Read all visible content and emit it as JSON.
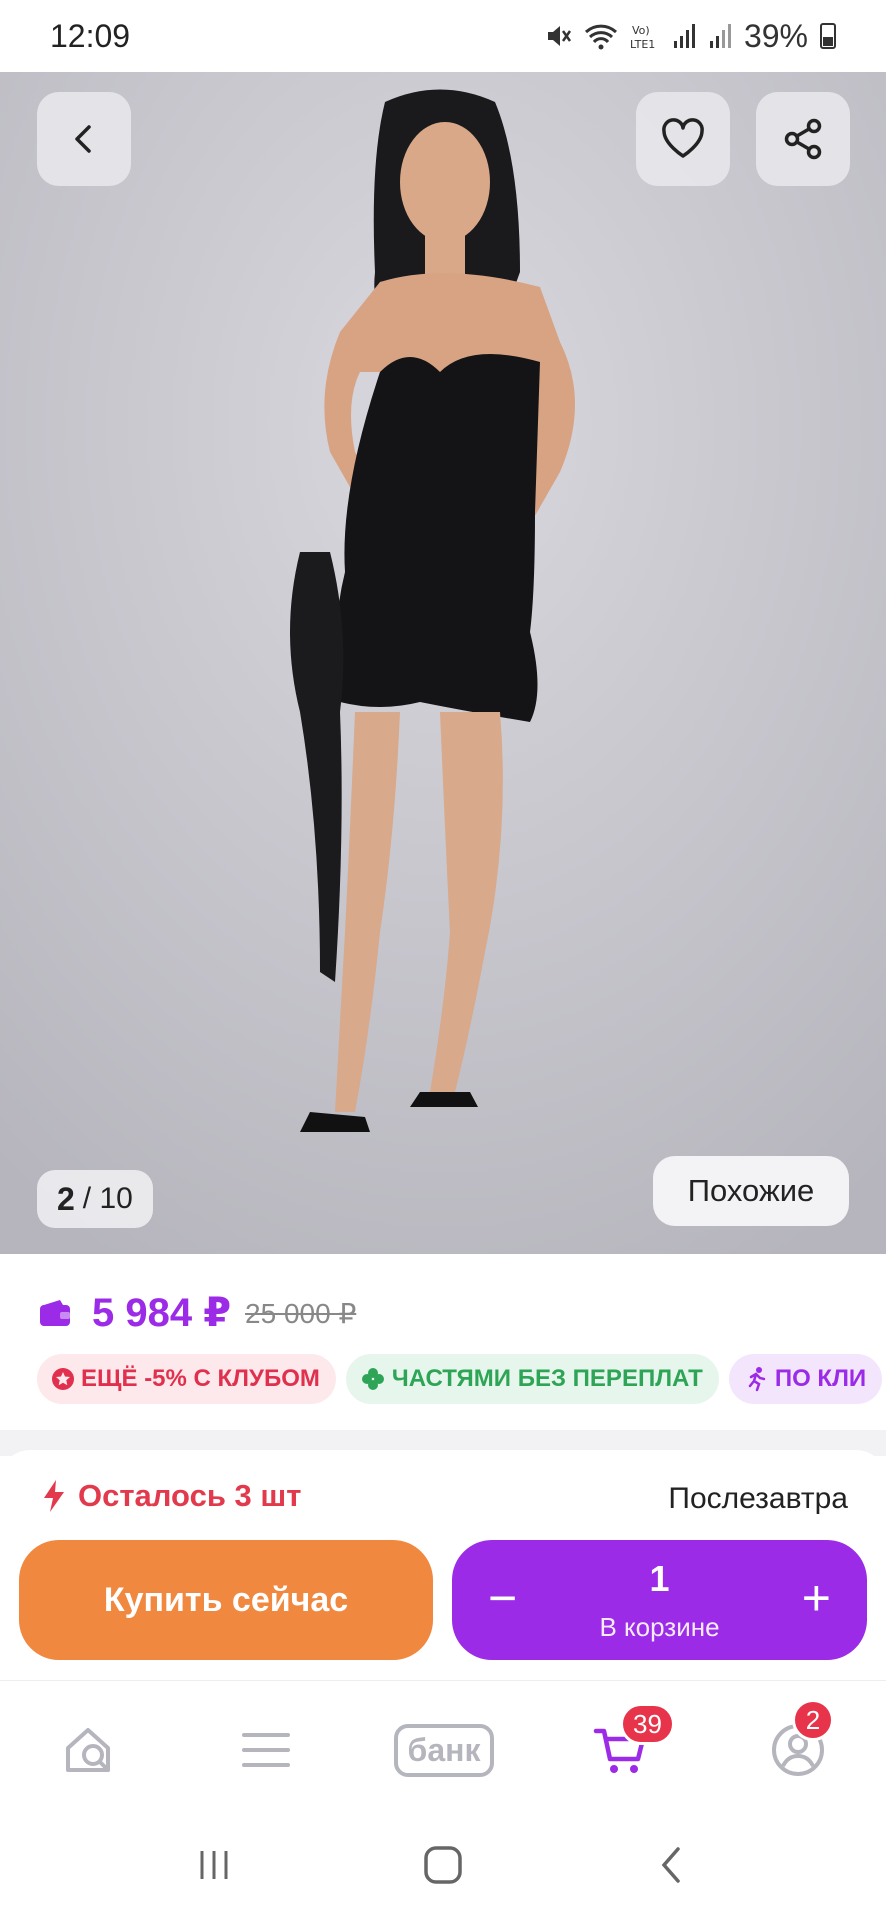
{
  "status_bar": {
    "time": "12:09",
    "battery": "39%"
  },
  "gallery": {
    "current": "2",
    "total": "/ 10",
    "similar_label": "Похожие"
  },
  "product": {
    "price": "5 984 ₽",
    "old_price": "25 000 ₽"
  },
  "chips": [
    {
      "label": "ЕЩЁ -5% С КЛУБОМ"
    },
    {
      "label": "ЧАСТЯМИ БЕЗ ПЕРЕПЛАТ"
    },
    {
      "label": "ПО КЛИ"
    }
  ],
  "stock": {
    "text": "Осталось 3 шт",
    "delivery": "Послезавтра"
  },
  "actions": {
    "buy_now": "Купить сейчас",
    "minus": "−",
    "plus": "+",
    "quantity": "1",
    "in_cart": "В корзине"
  },
  "bottom_nav": {
    "bank": "банк",
    "cart_badge": "39",
    "profile_badge": "2"
  },
  "colors": {
    "accent": "#9b2be6",
    "buy": "#f0883f",
    "stock": "#e23a4c",
    "badge": "#e8344a"
  }
}
